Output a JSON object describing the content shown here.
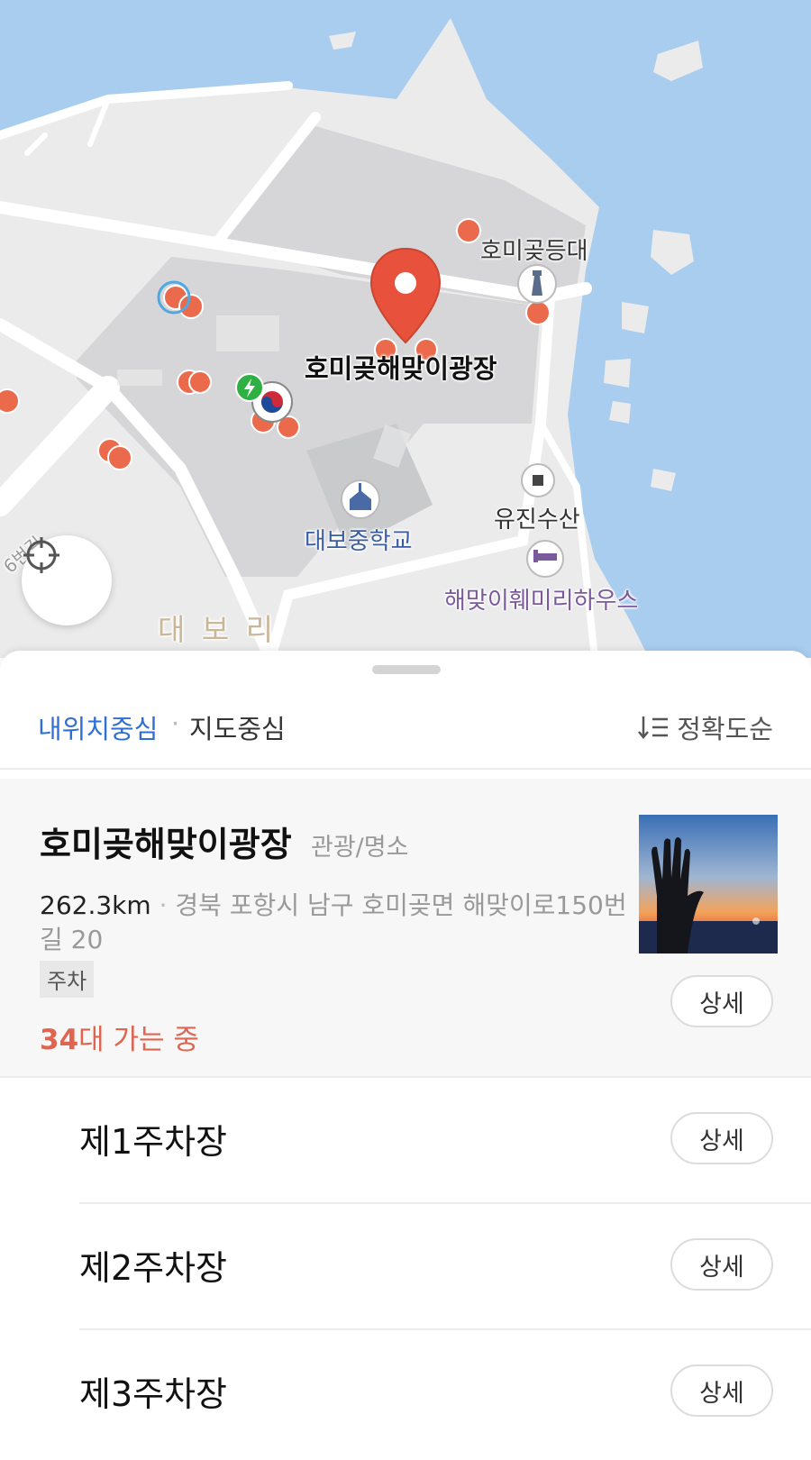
{
  "map": {
    "labels": {
      "place_pin": "호미곶해맞이광장",
      "lighthouse": "호미곶등대",
      "school": "대보중학교",
      "seafood": "유진수산",
      "guesthouse": "해맞이훼미리하우스",
      "district": "대 보 리",
      "road": "6번길"
    },
    "colors": {
      "sea": "#a9cdee",
      "land": "#ebebeb",
      "block": "#d6d6d8",
      "road": "#ffffff",
      "pin": "#e8523c",
      "poi": "#ec6a4c",
      "ev": "#2fb043"
    }
  },
  "locate_button": {
    "icon": "crosshair-icon"
  },
  "sheet": {
    "filters": {
      "my_location": "내위치중심",
      "separator": "·",
      "map_center": "지도중심",
      "sort": "정확도순",
      "sort_icon": "sort-icon"
    },
    "result": {
      "title": "호미곶해맞이광장",
      "category": "관광/명소",
      "distance": "262.3km",
      "dot": "·",
      "address": "경북 포항시 남구 호미곶면 해맞이로150번길 20",
      "tag": "주차",
      "going_count": "34",
      "going_text": "대 가는 중",
      "detail_label": "상세"
    },
    "sub_items": [
      {
        "name": "제1주차장",
        "detail_label": "상세"
      },
      {
        "name": "제2주차장",
        "detail_label": "상세"
      },
      {
        "name": "제3주차장",
        "detail_label": "상세"
      }
    ]
  }
}
